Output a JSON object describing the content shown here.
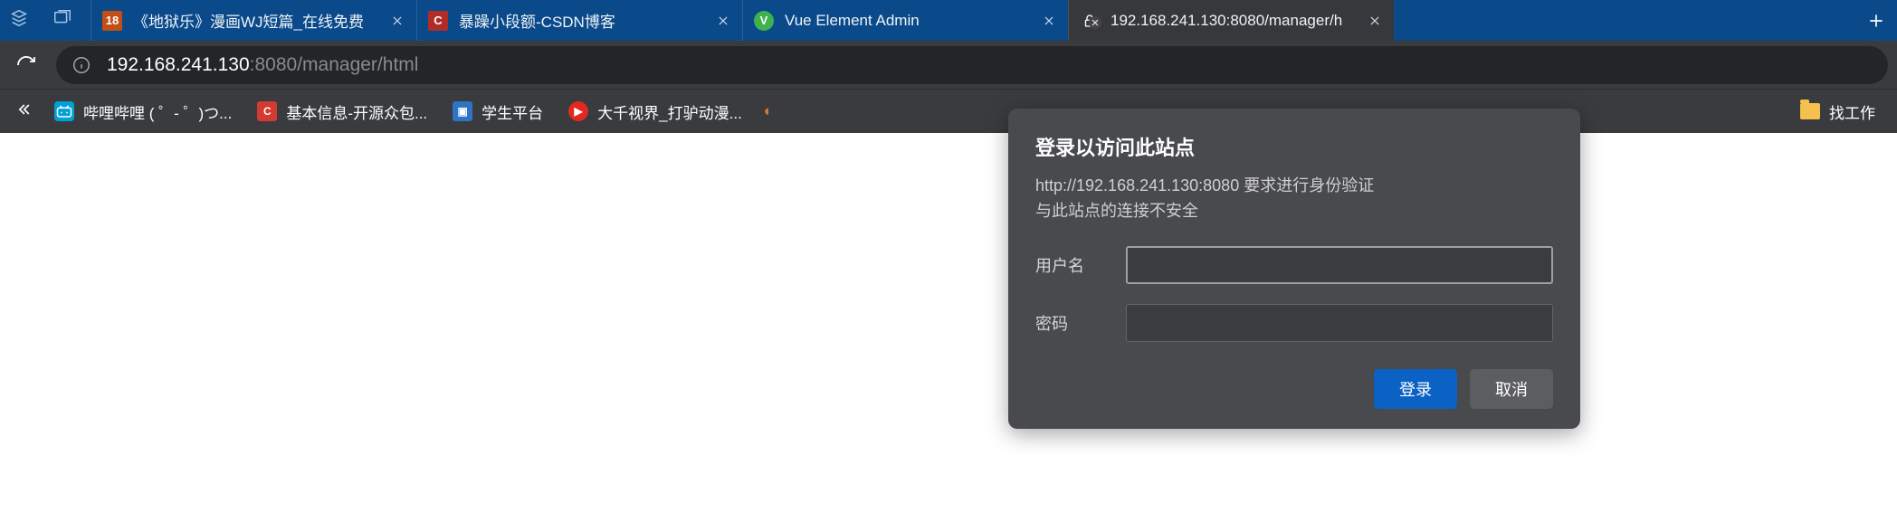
{
  "tabs": [
    {
      "title": "《地狱乐》漫画WJ短篇_在线免费",
      "favicon": "fav-orange",
      "favicon_text": "18"
    },
    {
      "title": "暴躁小段额-CSDN博客",
      "favicon": "fav-red",
      "favicon_text": "C"
    },
    {
      "title": "Vue Element Admin",
      "favicon": "fav-green",
      "favicon_text": "V"
    },
    {
      "title": "192.168.241.130:8080/manager/h",
      "favicon": "fav-lock",
      "favicon_text": ""
    }
  ],
  "url": {
    "host": "192.168.241.130",
    "port_path": ":8080/manager/html"
  },
  "bookmarks": [
    {
      "label": "哔哩哔哩 (  ゜- ゜)つ...",
      "icon_bg": "#00a1d6",
      "icon_text": "",
      "icon_preset": "bili"
    },
    {
      "label": "基本信息-开源众包...",
      "icon_bg": "#d23b32",
      "icon_text": "C"
    },
    {
      "label": "学生平台",
      "icon_bg": "#2d74c4",
      "icon_text": "▣"
    },
    {
      "label": "大千视界_打驴动漫...",
      "icon_bg": "#e22820",
      "icon_text": "▶"
    }
  ],
  "bookmarks_right": {
    "label": "找工作"
  },
  "auth": {
    "title": "登录以访问此站点",
    "line1": "http://192.168.241.130:8080 要求进行身份验证",
    "line2": "与此站点的连接不安全",
    "username_label": "用户名",
    "password_label": "密码",
    "username_value": "",
    "password_value": "",
    "signin_label": "登录",
    "cancel_label": "取消"
  }
}
